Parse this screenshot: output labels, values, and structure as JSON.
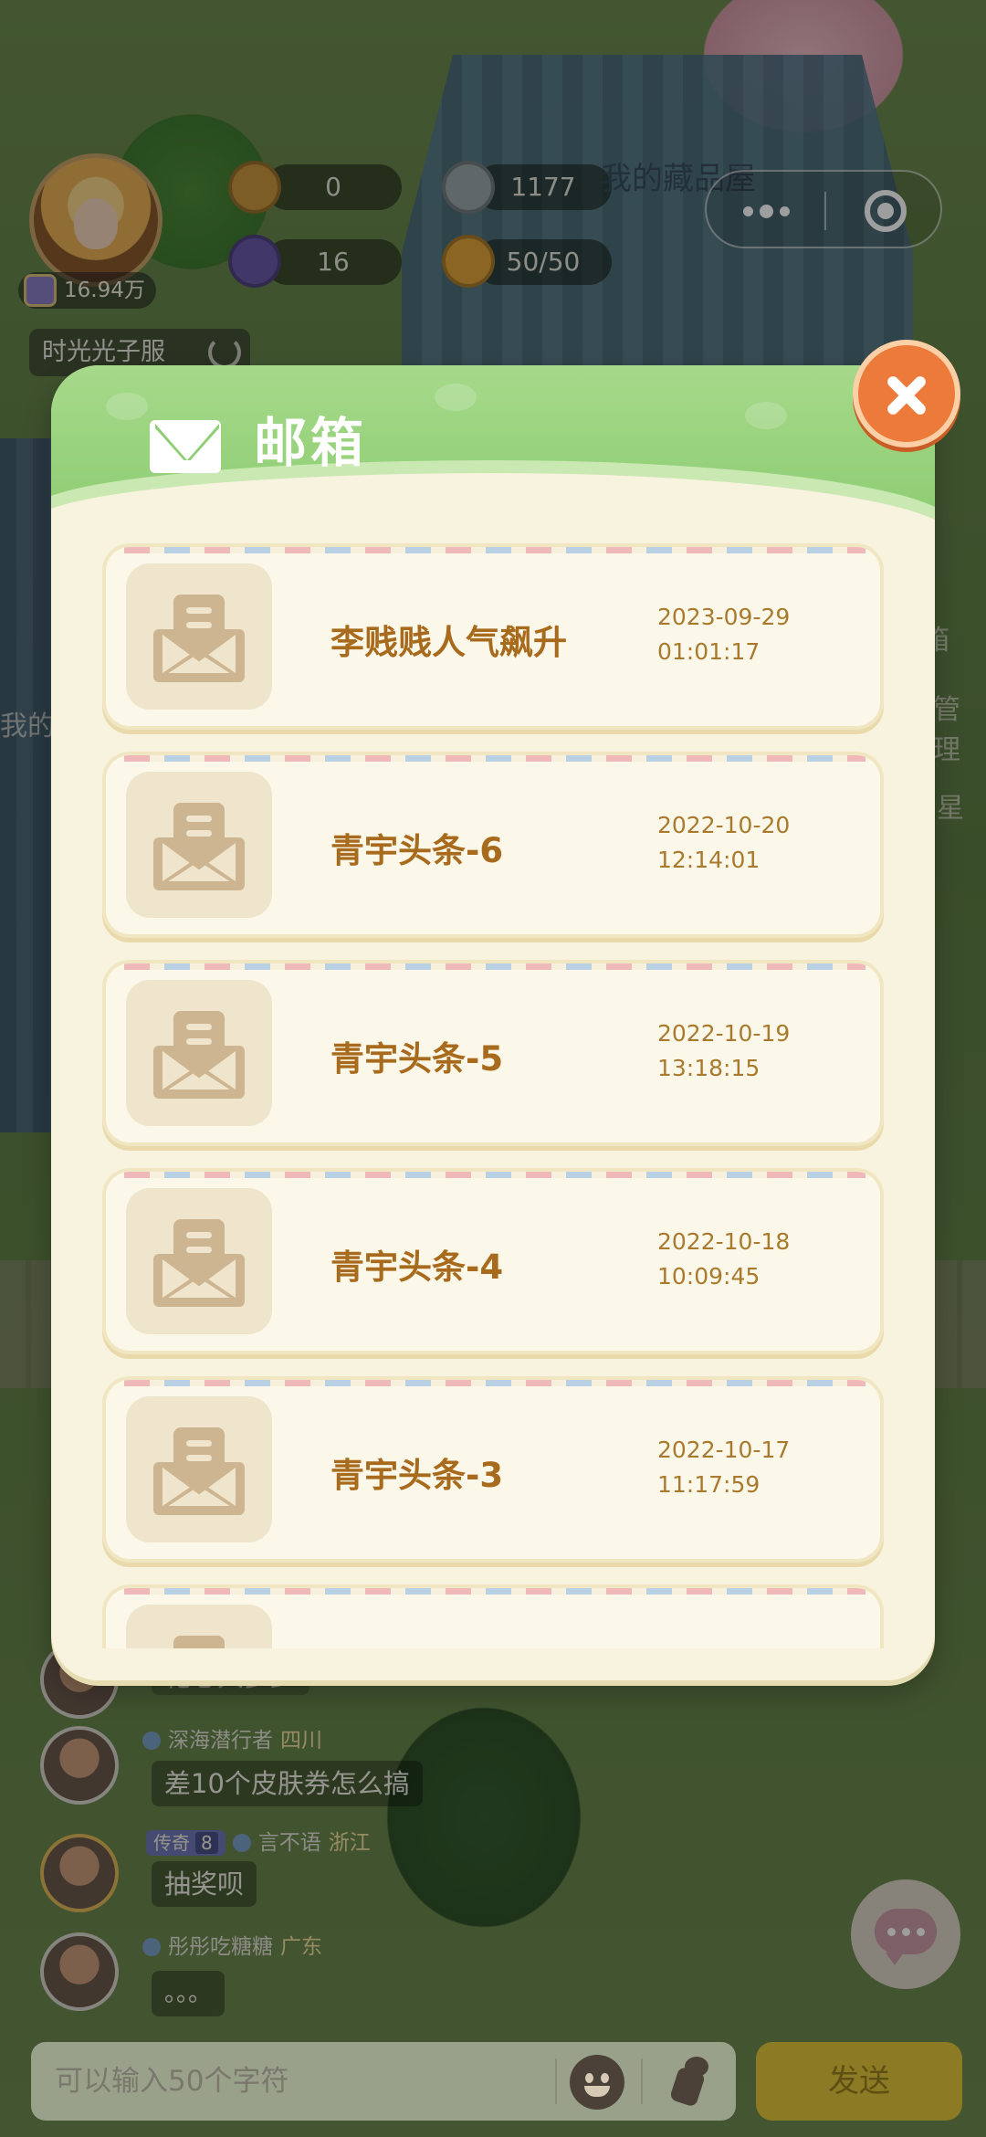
{
  "hud": {
    "level_value": "16.94万",
    "server_name": "时光光子服",
    "stats": [
      {
        "icon": "coin-icon",
        "value": "0",
        "color": "#c9963e"
      },
      {
        "icon": "cup-icon",
        "value": "1177",
        "color": "#9aa6a8"
      },
      {
        "icon": "gem-icon",
        "value": "16",
        "color": "#6a5aa8"
      },
      {
        "icon": "honey-jar-icon",
        "value": "50/50",
        "color": "#e0a43a"
      }
    ],
    "house_label": "我的藏品屋"
  },
  "background_labels": [
    "箱",
    "管理",
    "星",
    "我的"
  ],
  "mailbox": {
    "title": "邮箱",
    "items": [
      {
        "subject": "李贱贱人气飙升",
        "date": "2023-09-29",
        "time": "01:01:17"
      },
      {
        "subject": "青宇头条-6",
        "date": "2022-10-20",
        "time": "12:14:01"
      },
      {
        "subject": "青宇头条-5",
        "date": "2022-10-19",
        "time": "13:18:15"
      },
      {
        "subject": "青宇头条-4",
        "date": "2022-10-18",
        "time": "10:09:45"
      },
      {
        "subject": "青宇头条-3",
        "date": "2022-10-17",
        "time": "11:17:59"
      },
      {
        "subject": "",
        "date": "",
        "time": ""
      }
    ]
  },
  "chat": {
    "partial_message": "花心大多少",
    "messages": [
      {
        "name": "深海潜行者",
        "location": "四川",
        "text": "差10个皮肤券怎么搞"
      },
      {
        "rank": "传奇",
        "rank_level": "8",
        "name": "言不语",
        "location": "浙江",
        "text": "抽奖呗"
      },
      {
        "name": "彤彤吃糖糖",
        "location": "广东",
        "text": "。。。"
      }
    ]
  },
  "input": {
    "placeholder": "可以输入50个字符",
    "send_label": "发送"
  }
}
